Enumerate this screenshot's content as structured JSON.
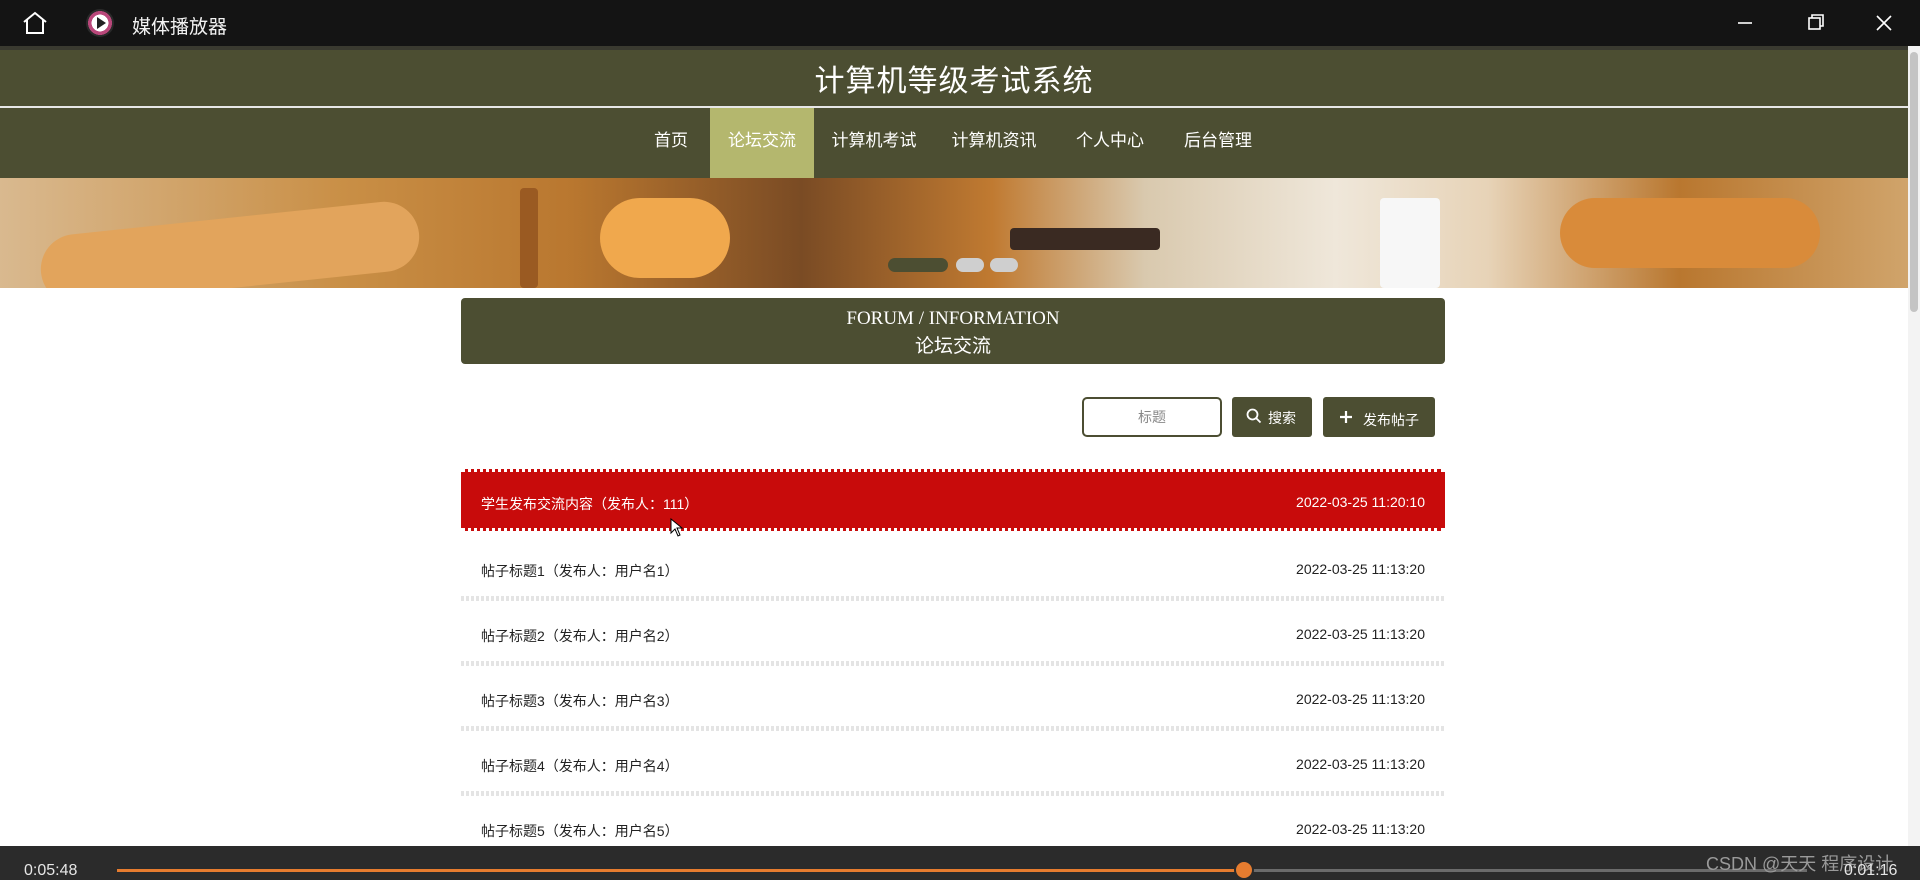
{
  "window": {
    "title": "媒体播放器",
    "icons": [
      "home-icon",
      "app-logo",
      "minimize-icon",
      "restore-icon",
      "close-icon"
    ]
  },
  "site": {
    "title": "计算机等级考试系统"
  },
  "nav": {
    "items": [
      {
        "label": "首页"
      },
      {
        "label": "论坛交流",
        "active": true
      },
      {
        "label": "计算机考试"
      },
      {
        "label": "计算机资讯"
      },
      {
        "label": "个人中心"
      },
      {
        "label": "后台管理"
      }
    ]
  },
  "banner": {
    "active_slide": 1,
    "slides": 3
  },
  "forum": {
    "title_en": "FORUM / INFORMATION",
    "title_cn": "论坛交流"
  },
  "search": {
    "placeholder": "标题",
    "search_label": "搜索",
    "post_label": "发布帖子",
    "search_icon": "search-icon",
    "post_icon": "plus-icon"
  },
  "posts": [
    {
      "title": "学生发布交流内容（发布人：111）",
      "date": "2022-03-25 11:20:10",
      "highlighted": true
    },
    {
      "title": "帖子标题1（发布人：用户名1）",
      "date": "2022-03-25 11:13:20"
    },
    {
      "title": "帖子标题2（发布人：用户名2）",
      "date": "2022-03-25 11:13:20"
    },
    {
      "title": "帖子标题3（发布人：用户名3）",
      "date": "2022-03-25 11:13:20"
    },
    {
      "title": "帖子标题4（发布人：用户名4）",
      "date": "2022-03-25 11:13:20"
    },
    {
      "title": "帖子标题5（发布人：用户名5）",
      "date": "2022-03-25 11:13:20"
    }
  ],
  "player": {
    "current_time": "0:05:48",
    "duration": "0:01:16",
    "progress": 0.667
  },
  "watermark": "CSDN @天天 程序设计",
  "colors": {
    "theme": "#4c4e32",
    "active_nav": "#b4b76e",
    "highlight_row": "#c80b0b",
    "progress": "#e67c2f"
  }
}
